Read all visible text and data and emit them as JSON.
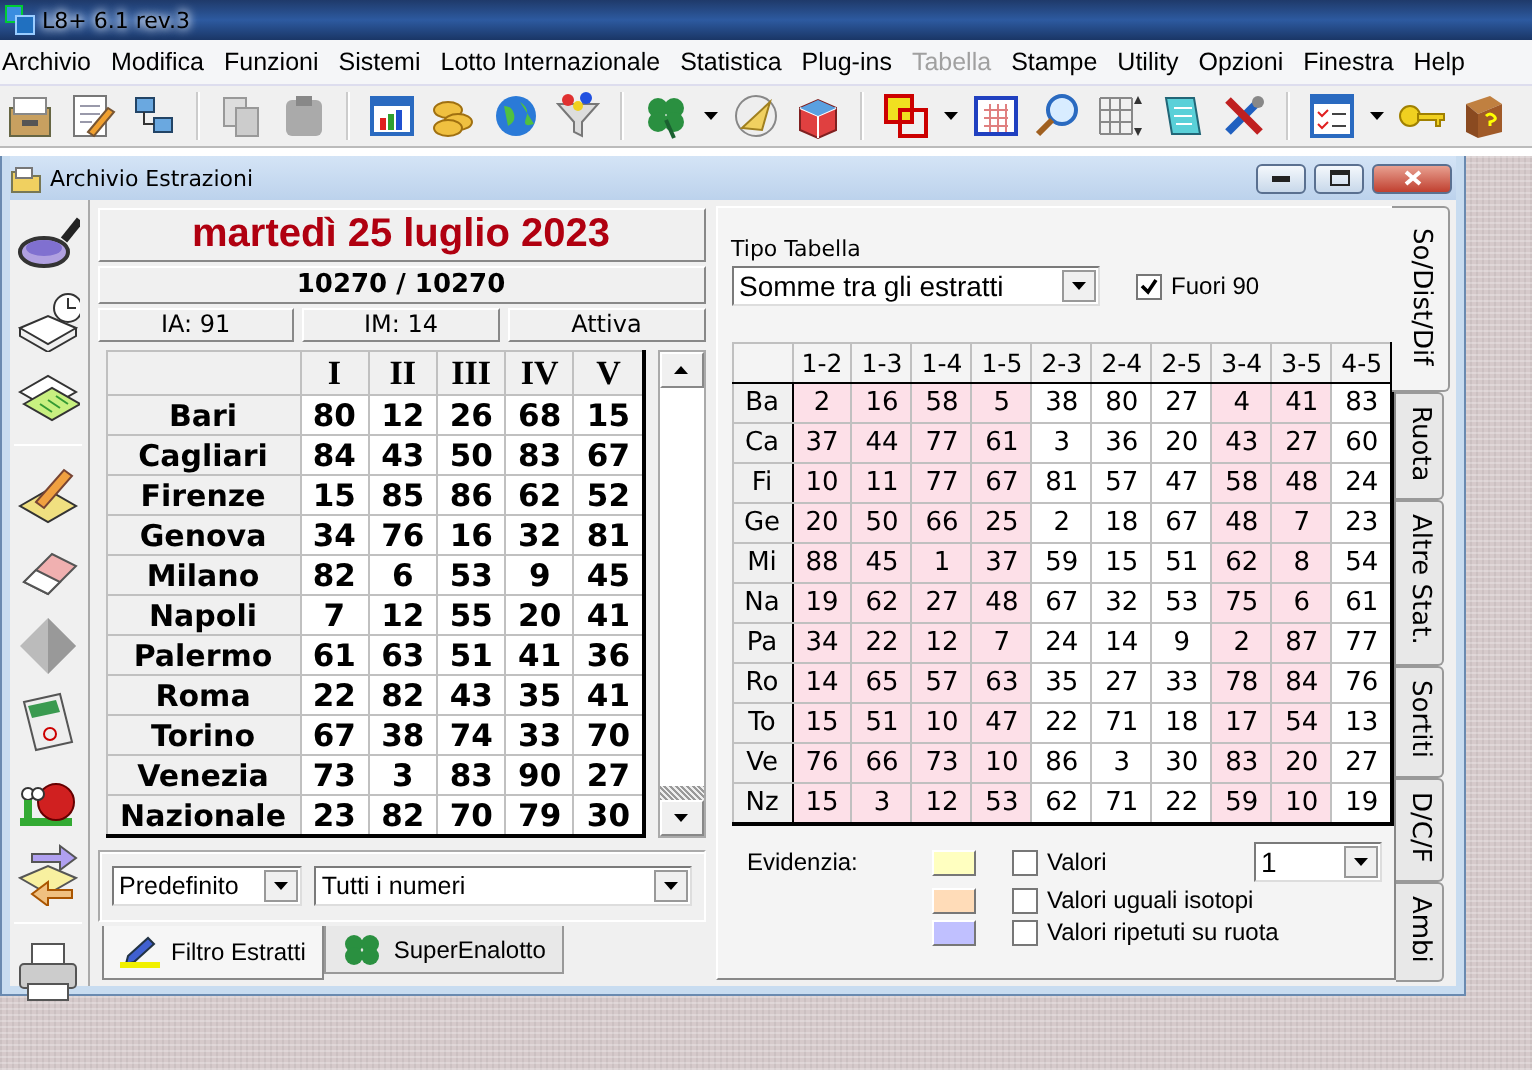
{
  "app": {
    "title": "L8+ 6.1 rev.3"
  },
  "menu": [
    {
      "label": "Archivio",
      "disabled": false
    },
    {
      "label": "Modifica",
      "disabled": false
    },
    {
      "label": "Funzioni",
      "disabled": false
    },
    {
      "label": "Sistemi",
      "disabled": false
    },
    {
      "label": "Lotto Internazionale",
      "disabled": false
    },
    {
      "label": "Statistica",
      "disabled": false
    },
    {
      "label": "Plug-ins",
      "disabled": false
    },
    {
      "label": "Tabella",
      "disabled": true
    },
    {
      "label": "Stampe",
      "disabled": false
    },
    {
      "label": "Utility",
      "disabled": false
    },
    {
      "label": "Opzioni",
      "disabled": false
    },
    {
      "label": "Finestra",
      "disabled": false
    },
    {
      "label": "Help",
      "disabled": false
    }
  ],
  "child_window": {
    "title": "Archivio Estrazioni"
  },
  "draw": {
    "date": "martedì 25 luglio 2023",
    "counter": "10270 / 10270",
    "ia": "IA: 91",
    "im": "IM: 14",
    "status": "Attiva"
  },
  "extractions": {
    "columns": [
      "I",
      "II",
      "III",
      "IV",
      "V"
    ],
    "rows": [
      {
        "wheel": "Bari",
        "numbers": [
          "80",
          "12",
          "26",
          "68",
          "15"
        ]
      },
      {
        "wheel": "Cagliari",
        "numbers": [
          "84",
          "43",
          "50",
          "83",
          "67"
        ]
      },
      {
        "wheel": "Firenze",
        "numbers": [
          "15",
          "85",
          "86",
          "62",
          "52"
        ]
      },
      {
        "wheel": "Genova",
        "numbers": [
          "34",
          "76",
          "16",
          "32",
          "81"
        ]
      },
      {
        "wheel": "Milano",
        "numbers": [
          "82",
          "6",
          "53",
          "9",
          "45"
        ]
      },
      {
        "wheel": "Napoli",
        "numbers": [
          "7",
          "12",
          "55",
          "20",
          "41"
        ]
      },
      {
        "wheel": "Palermo",
        "numbers": [
          "61",
          "63",
          "51",
          "41",
          "36"
        ]
      },
      {
        "wheel": "Roma",
        "numbers": [
          "22",
          "82",
          "43",
          "35",
          "41"
        ]
      },
      {
        "wheel": "Torino",
        "numbers": [
          "67",
          "38",
          "74",
          "33",
          "70"
        ]
      },
      {
        "wheel": "Venezia",
        "numbers": [
          "73",
          "3",
          "83",
          "90",
          "27"
        ]
      },
      {
        "wheel": "Nazionale",
        "numbers": [
          "23",
          "82",
          "70",
          "79",
          "30"
        ]
      }
    ]
  },
  "filters": {
    "preset": "Predefinito",
    "numbers": "Tutti i numeri"
  },
  "bottom_tabs": [
    {
      "label": "Filtro Estratti",
      "selected": true
    },
    {
      "label": "SuperEnalotto",
      "selected": false
    }
  ],
  "table_type": {
    "label": "Tipo Tabella",
    "value": "Somme tra gli estratti"
  },
  "fuori_90": {
    "label": "Fuori 90",
    "checked": true
  },
  "pairs": {
    "columns": [
      {
        "label": "1-2",
        "shaded": true
      },
      {
        "label": "1-3",
        "shaded": true
      },
      {
        "label": "1-4",
        "shaded": true
      },
      {
        "label": "1-5",
        "shaded": true
      },
      {
        "label": "2-3",
        "shaded": false
      },
      {
        "label": "2-4",
        "shaded": false
      },
      {
        "label": "2-5",
        "shaded": false
      },
      {
        "label": "3-4",
        "shaded": true
      },
      {
        "label": "3-5",
        "shaded": true
      },
      {
        "label": "4-5",
        "shaded": false
      }
    ],
    "rows": [
      {
        "wheel": "Ba",
        "values": [
          "2",
          "16",
          "58",
          "5",
          "38",
          "80",
          "27",
          "4",
          "41",
          "83"
        ]
      },
      {
        "wheel": "Ca",
        "values": [
          "37",
          "44",
          "77",
          "61",
          "3",
          "36",
          "20",
          "43",
          "27",
          "60"
        ]
      },
      {
        "wheel": "Fi",
        "values": [
          "10",
          "11",
          "77",
          "67",
          "81",
          "57",
          "47",
          "58",
          "48",
          "24"
        ]
      },
      {
        "wheel": "Ge",
        "values": [
          "20",
          "50",
          "66",
          "25",
          "2",
          "18",
          "67",
          "48",
          "7",
          "23"
        ]
      },
      {
        "wheel": "Mi",
        "values": [
          "88",
          "45",
          "1",
          "37",
          "59",
          "15",
          "51",
          "62",
          "8",
          "54"
        ]
      },
      {
        "wheel": "Na",
        "values": [
          "19",
          "62",
          "27",
          "48",
          "67",
          "32",
          "53",
          "75",
          "6",
          "61"
        ]
      },
      {
        "wheel": "Pa",
        "values": [
          "34",
          "22",
          "12",
          "7",
          "24",
          "14",
          "9",
          "2",
          "87",
          "77"
        ]
      },
      {
        "wheel": "Ro",
        "values": [
          "14",
          "65",
          "57",
          "63",
          "35",
          "27",
          "33",
          "78",
          "84",
          "76"
        ]
      },
      {
        "wheel": "To",
        "values": [
          "15",
          "51",
          "10",
          "47",
          "22",
          "71",
          "18",
          "17",
          "54",
          "13"
        ]
      },
      {
        "wheel": "Ve",
        "values": [
          "76",
          "66",
          "73",
          "10",
          "86",
          "3",
          "30",
          "83",
          "20",
          "27"
        ]
      },
      {
        "wheel": "Nz",
        "values": [
          "15",
          "3",
          "12",
          "53",
          "62",
          "71",
          "22",
          "59",
          "10",
          "19"
        ]
      }
    ]
  },
  "highlight": {
    "label": "Evidenzia:",
    "count": "1",
    "options": [
      {
        "label": "Valori",
        "color": "#ffffc0",
        "checked": false
      },
      {
        "label": "Valori uguali isotopi",
        "color": "#ffdcb8",
        "checked": false
      },
      {
        "label": "Valori ripetuti su ruota",
        "color": "#c0c0ff",
        "checked": false
      }
    ]
  },
  "side_tabs": [
    {
      "label": "So/Dist/Dif",
      "selected": true
    },
    {
      "label": "Ruota",
      "selected": false
    },
    {
      "label": "Altre Stat.",
      "selected": false
    },
    {
      "label": "Sortiti",
      "selected": false
    },
    {
      "label": "D/C/F",
      "selected": false
    },
    {
      "label": "Ambi",
      "selected": false
    }
  ]
}
